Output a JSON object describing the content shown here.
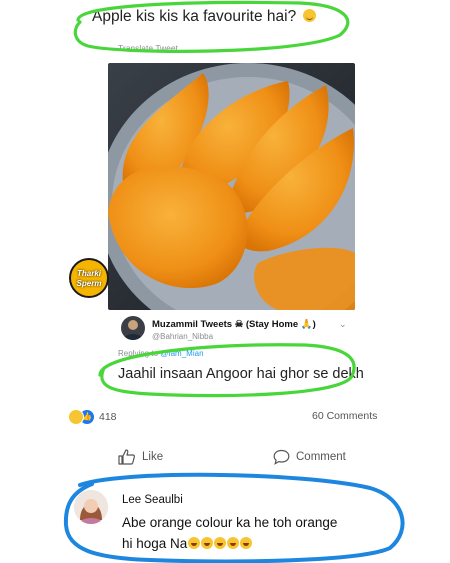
{
  "post": {
    "text": "Apple kis kis ka favourite hai?",
    "emoji_icon": "smiling-face-icon",
    "translate_label": "Translate Tweet"
  },
  "watermark": {
    "line1": "Tharki",
    "line2": "Sperm"
  },
  "tweet": {
    "name": "Muzammil Tweets ☠ (Stay Home 🙏)",
    "handle": "@Bahrian_Nibba",
    "replying_prefix": "Replying to",
    "replying_to": "@Iam_Mian",
    "text": "Jaahil insaan Angoor hai ghor se dekh"
  },
  "reactions": {
    "count": "418",
    "comments": "60 Comments"
  },
  "actions": {
    "like": "Like",
    "comment": "Comment"
  },
  "comment": {
    "author": "Lee Seaulbi",
    "line1": "Abe orange colour ka he toh orange",
    "line2": "hi hoga Na"
  },
  "colors": {
    "highlight_green": "#49d63a",
    "highlight_blue": "#1d87e0",
    "mango": "#f29a1e"
  }
}
